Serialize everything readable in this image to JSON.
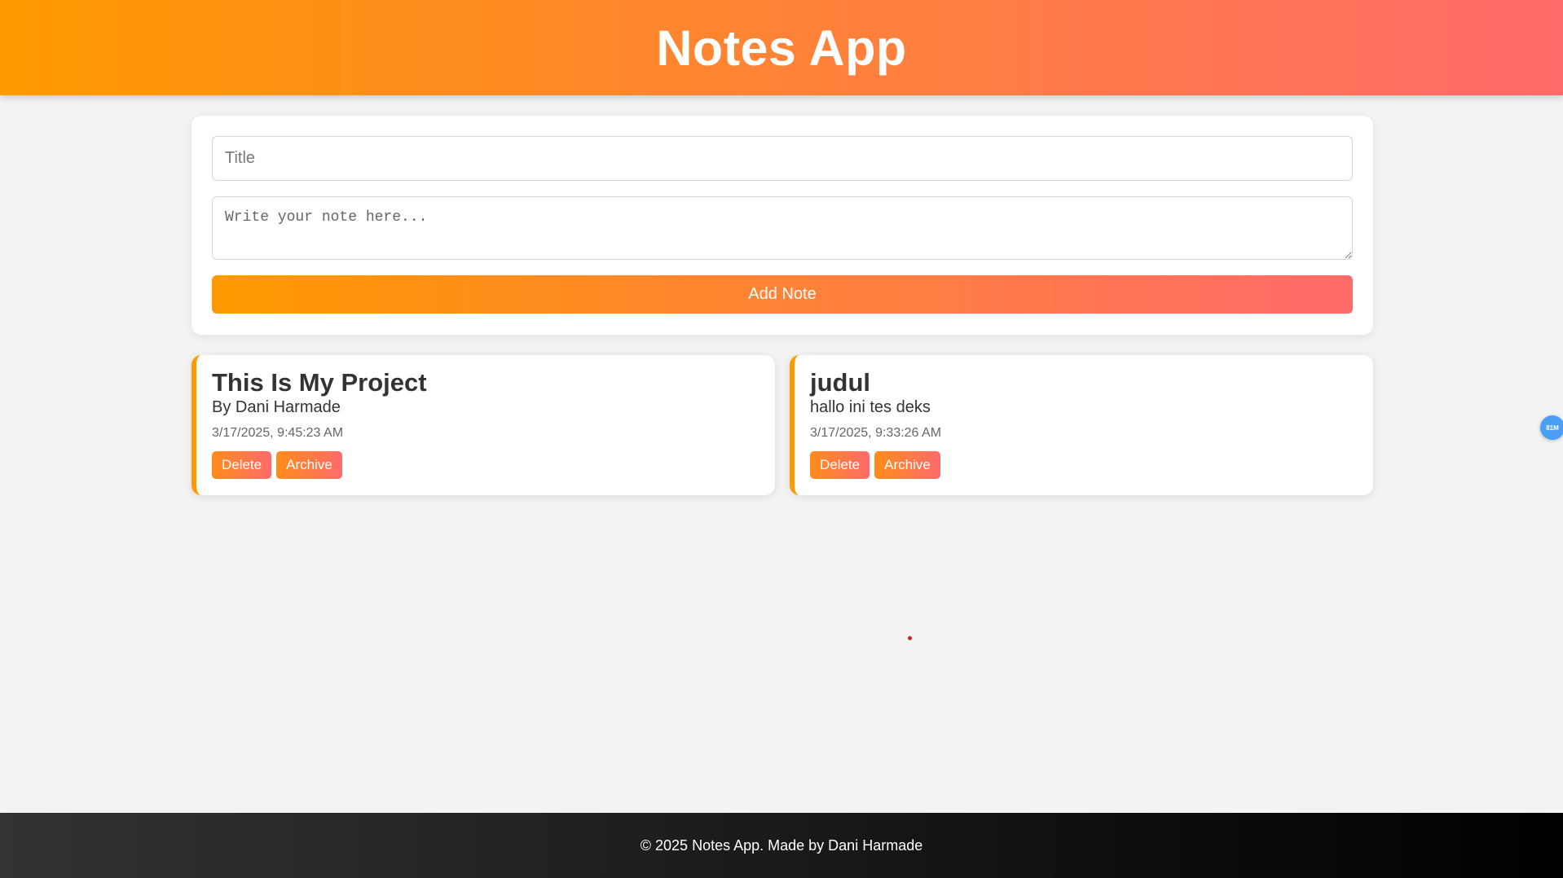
{
  "header": {
    "title": "Notes App"
  },
  "form": {
    "title_placeholder": "Title",
    "title_value": "",
    "note_placeholder": "Write your note here...",
    "note_value": "",
    "add_label": "Add Note"
  },
  "notes": [
    {
      "title": "This Is My Project",
      "body": "By Dani Harmade",
      "date": "3/17/2025, 9:45:23 AM",
      "delete_label": "Delete",
      "archive_label": "Archive"
    },
    {
      "title": "judul",
      "body": "hallo ini tes deks",
      "date": "3/17/2025, 9:33:26 AM",
      "delete_label": "Delete",
      "archive_label": "Archive"
    }
  ],
  "side_badge": {
    "label": "81M"
  },
  "footer": {
    "text": "© 2025 Notes App. Made by Dani Harmade"
  },
  "colors": {
    "accent_start": "#ff9a00",
    "accent_end": "#ff6b6b",
    "background": "#f3f3f3",
    "footer": "#000000"
  }
}
